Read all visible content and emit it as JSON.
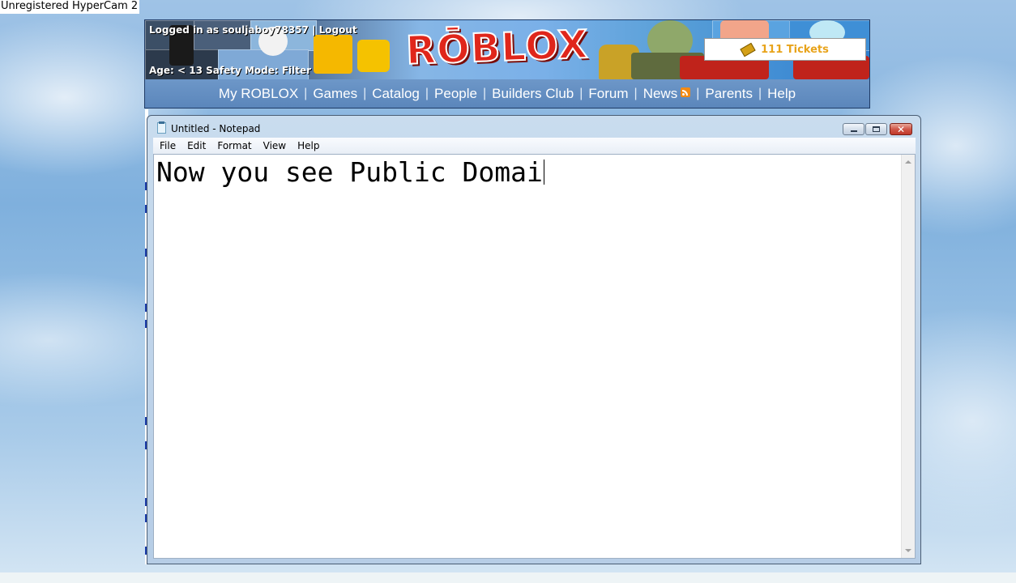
{
  "watermark": "Unregistered HyperCam 2",
  "roblox": {
    "user_line": "Logged in as souljaboy78357 | Logout",
    "age_line": "Age: <  13  Safety Mode: Filter",
    "logo": "RŌBLOX",
    "tickets": "111 Tickets",
    "nav": [
      {
        "label": "My ROBLOX"
      },
      {
        "label": "Games"
      },
      {
        "label": "Catalog"
      },
      {
        "label": "People"
      },
      {
        "label": "Builders Club"
      },
      {
        "label": "Forum"
      },
      {
        "label": "News"
      },
      {
        "label": "Parents"
      },
      {
        "label": "Help"
      }
    ],
    "icons": {
      "ticket": "ticket-icon",
      "rss": "rss-feed-icon"
    },
    "colors": {
      "logo_red": "#e0261b",
      "nav_bar": "#5b86bb",
      "tickets_text": "#e8a31a"
    }
  },
  "notepad": {
    "title": "Untitled - Notepad",
    "menu": [
      "File",
      "Edit",
      "Format",
      "View",
      "Help"
    ],
    "content": "Now you see Public Domai",
    "controls": {
      "minimize": "minimize-icon",
      "maximize": "maximize-icon",
      "close": "close-icon"
    }
  }
}
